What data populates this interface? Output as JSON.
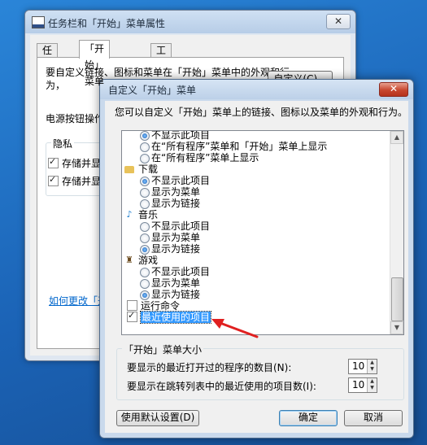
{
  "back_window": {
    "title": "任务栏和「开始」菜单属性",
    "close": "✕",
    "tabs": [
      "任务栏",
      "「开始」菜单",
      "工具栏"
    ],
    "description": "要自定义链接、图标和菜单在「开始」菜单中的外观和行为，",
    "customize_button": "自定义(C)...",
    "power_label": "电源按钮操作",
    "privacy_group": "隐私",
    "privacy_item_1": "存储并显",
    "privacy_item_2": "存储并显",
    "link_text": "如何更改「开"
  },
  "dialog": {
    "title": "自定义「开始」菜单",
    "close": "✕",
    "intro": "您可以自定义「开始」菜单上的链接、图标以及菜单的外观和行为。",
    "list": [
      {
        "kind": "opt",
        "label": "不显示此项目",
        "selected": true
      },
      {
        "kind": "opt",
        "label": "在“所有程序”菜单和「开始」菜单上显示",
        "selected": false
      },
      {
        "kind": "opt",
        "label": "在“所有程序”菜单上显示",
        "selected": false
      },
      {
        "kind": "cat",
        "label": "下载",
        "icon": "folder-icon"
      },
      {
        "kind": "opt",
        "label": "不显示此项目",
        "selected": true
      },
      {
        "kind": "opt",
        "label": "显示为菜单",
        "selected": false
      },
      {
        "kind": "opt",
        "label": "显示为链接",
        "selected": false
      },
      {
        "kind": "cat",
        "label": "音乐",
        "icon": "music-note-icon"
      },
      {
        "kind": "opt",
        "label": "不显示此项目",
        "selected": false
      },
      {
        "kind": "opt",
        "label": "显示为菜单",
        "selected": false
      },
      {
        "kind": "opt",
        "label": "显示为链接",
        "selected": true
      },
      {
        "kind": "cat",
        "label": "游戏",
        "icon": "game-controller-icon"
      },
      {
        "kind": "opt",
        "label": "不显示此项目",
        "selected": false
      },
      {
        "kind": "opt",
        "label": "显示为菜单",
        "selected": false
      },
      {
        "kind": "opt",
        "label": "显示为链接",
        "selected": true
      },
      {
        "kind": "chk",
        "label": "运行命令",
        "checked": false
      },
      {
        "kind": "chk",
        "label": "最近使用的项目",
        "checked": true,
        "highlighted": true
      }
    ],
    "size_group_title": "「开始」菜单大小",
    "recent_programs_label": "要显示的最近打开过的程序的数目(N):",
    "recent_programs_value": "10",
    "jumplist_label": "要显示在跳转列表中的最近使用的项目数(I):",
    "jumplist_value": "10",
    "default_button": "使用默认设置(D)",
    "ok_button": "确定",
    "cancel_button": "取消",
    "highlight_color": "#3399ff",
    "annotation_arrow_color": "#e02020"
  }
}
